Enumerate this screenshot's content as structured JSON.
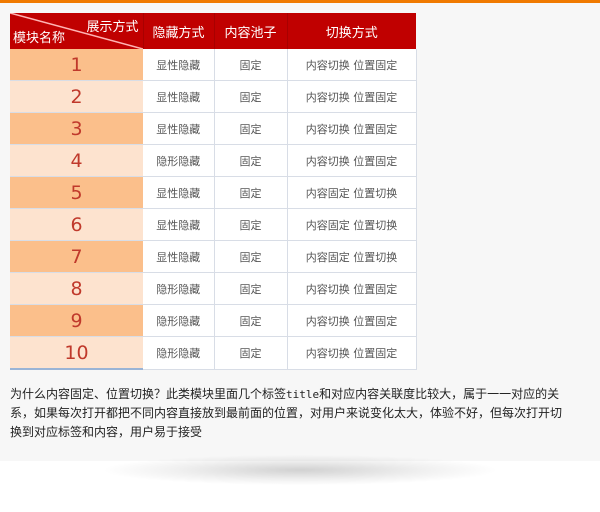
{
  "table": {
    "corner_top_right": "展示方式",
    "corner_bottom_left": "模块名称",
    "columns": [
      "隐藏方式",
      "内容池子",
      "切换方式"
    ],
    "rows": [
      {
        "id": "1",
        "hide": "显性隐藏",
        "pool": "固定",
        "switch": "内容切换 位置固定"
      },
      {
        "id": "2",
        "hide": "显性隐藏",
        "pool": "固定",
        "switch": "内容切换 位置固定"
      },
      {
        "id": "3",
        "hide": "显性隐藏",
        "pool": "固定",
        "switch": "内容切换 位置固定"
      },
      {
        "id": "4",
        "hide": "隐形隐藏",
        "pool": "固定",
        "switch": "内容切换 位置固定"
      },
      {
        "id": "5",
        "hide": "显性隐藏",
        "pool": "固定",
        "switch": "内容固定 位置切换"
      },
      {
        "id": "6",
        "hide": "显性隐藏",
        "pool": "固定",
        "switch": "内容固定 位置切换"
      },
      {
        "id": "7",
        "hide": "显性隐藏",
        "pool": "固定",
        "switch": "内容固定 位置切换"
      },
      {
        "id": "8",
        "hide": "隐形隐藏",
        "pool": "固定",
        "switch": "内容切换 位置固定"
      },
      {
        "id": "9",
        "hide": "隐形隐藏",
        "pool": "固定",
        "switch": "内容切换 位置固定"
      },
      {
        "id": "10",
        "hide": "隐形隐藏",
        "pool": "固定",
        "switch": "内容切换 位置固定"
      }
    ]
  },
  "description": {
    "part1": "为什么内容固定、位置切换？此类模块里面几个标签",
    "keyword": "title",
    "part2": "和对应内容关联度比较大，属于一一对应的关系，如果每次打开都把不同内容直接放到最前面的位置，对用户来说变化太大，体验不好，但每次打开切换到对应标签和内容，用户易于接受"
  },
  "colors": {
    "header": "#c00000",
    "accent_bar": "#f07a00",
    "row_odd_number": "#fbbf8b",
    "row_even_number": "#fde3cf",
    "number_text": "#c0392b"
  }
}
